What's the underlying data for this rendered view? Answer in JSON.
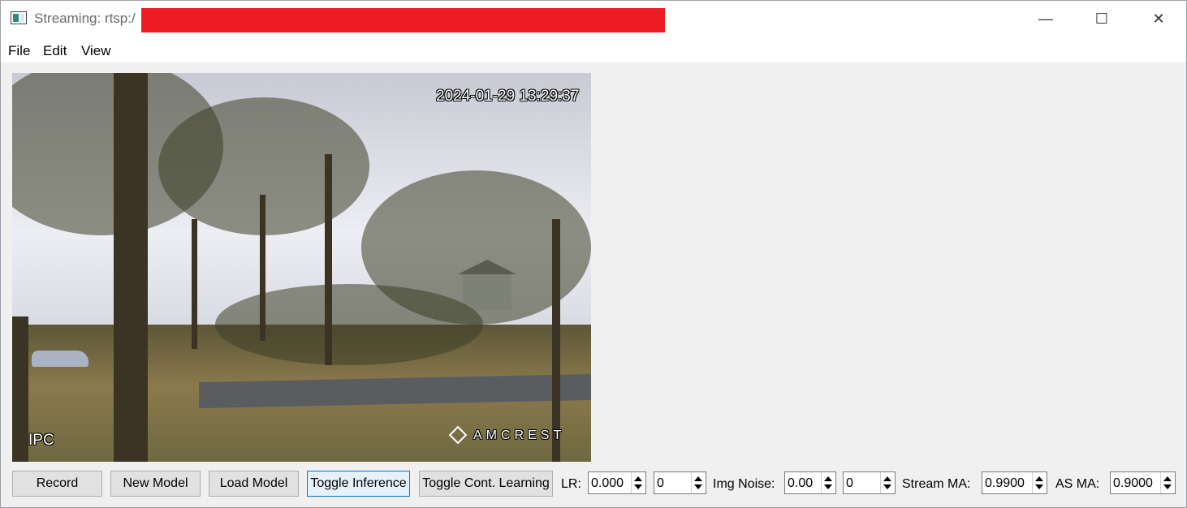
{
  "window": {
    "title": "Streaming: rtsp:/",
    "controls": {
      "minimize": "—",
      "maximize": "☐",
      "close": "✕"
    }
  },
  "menu": [
    "File",
    "Edit",
    "View"
  ],
  "video": {
    "timestamp": "2024-01-29 13:29:37",
    "label": "IPC",
    "brand": "AMCREST"
  },
  "toolbar": {
    "buttons": [
      "Record",
      "New Model",
      "Load Model",
      "Toggle Inference",
      "Toggle Cont. Learning"
    ],
    "lr_label": "LR:",
    "lr_value": "0.000",
    "lr_step": "0",
    "noise_label": "Img Noise:",
    "noise_value": "0.00",
    "noise_step": "0",
    "stream_ma_label": "Stream MA:",
    "stream_ma_value": "0.9900",
    "as_ma_label": "AS MA:",
    "as_ma_value": "0.9000"
  },
  "colors": {
    "redaction": "#ed1c24",
    "accent": "#0078d7"
  }
}
